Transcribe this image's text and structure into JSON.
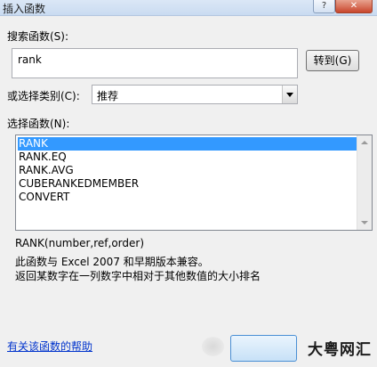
{
  "window": {
    "title": "插入函数",
    "help_label": "?",
    "close_label": "✕"
  },
  "search": {
    "label": "搜索函数(S):",
    "value": "rank",
    "go_label": "转到(G)"
  },
  "category": {
    "label": "或选择类别(C):",
    "selected": "推荐"
  },
  "functions": {
    "label": "选择函数(N):",
    "items": [
      "RANK",
      "RANK.EQ",
      "RANK.AVG",
      "CUBERANKEDMEMBER",
      "CONVERT"
    ],
    "selected_index": 0
  },
  "details": {
    "signature": "RANK(number,ref,order)",
    "line1": "此函数与 Excel 2007 和早期版本兼容。",
    "line2": "返回某数字在一列数字中相对于其他数值的大小排名"
  },
  "footer": {
    "help_link": "有关该函数的帮助",
    "watermark": "大粤网汇"
  },
  "colors": {
    "selection": "#3399ff",
    "link": "#0033cc",
    "dialog_bg": "#f0f0f0"
  }
}
